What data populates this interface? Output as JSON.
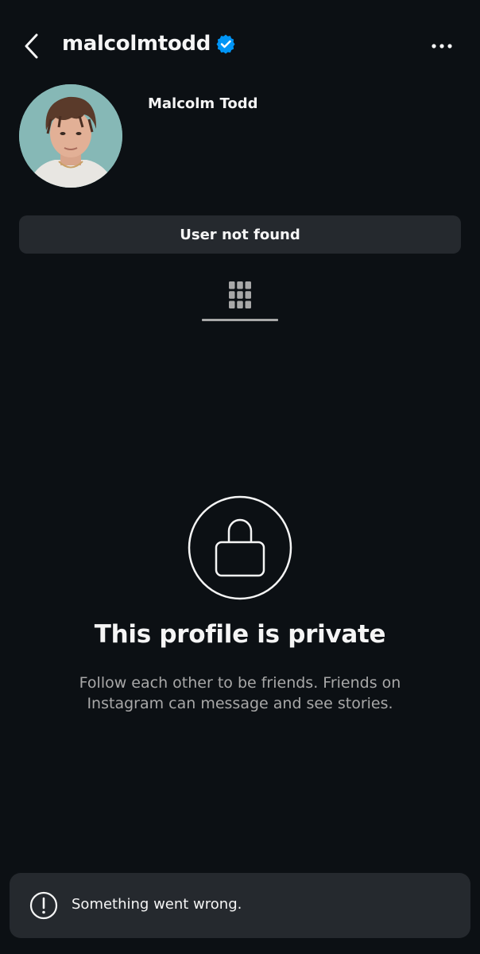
{
  "header": {
    "username": "malcolmtodd",
    "verified": true,
    "back_icon": "chevron-left-icon",
    "more_icon": "ellipsis-icon"
  },
  "profile": {
    "display_name": "Malcolm Todd",
    "status_button_label": "User not found"
  },
  "tabs": [
    {
      "icon": "grid-icon",
      "active": true
    }
  ],
  "private_notice": {
    "icon": "lock-icon",
    "title": "This profile is private",
    "description": "Follow each other to be friends. Friends on Instagram can message and see stories."
  },
  "toast": {
    "icon": "alert-circle-icon",
    "message": "Something went wrong."
  },
  "colors": {
    "background": "#0c1014",
    "surface": "#25292e",
    "text_primary": "#f5f5f5",
    "text_secondary": "#a8a8a8",
    "verified_blue": "#0095f6"
  }
}
